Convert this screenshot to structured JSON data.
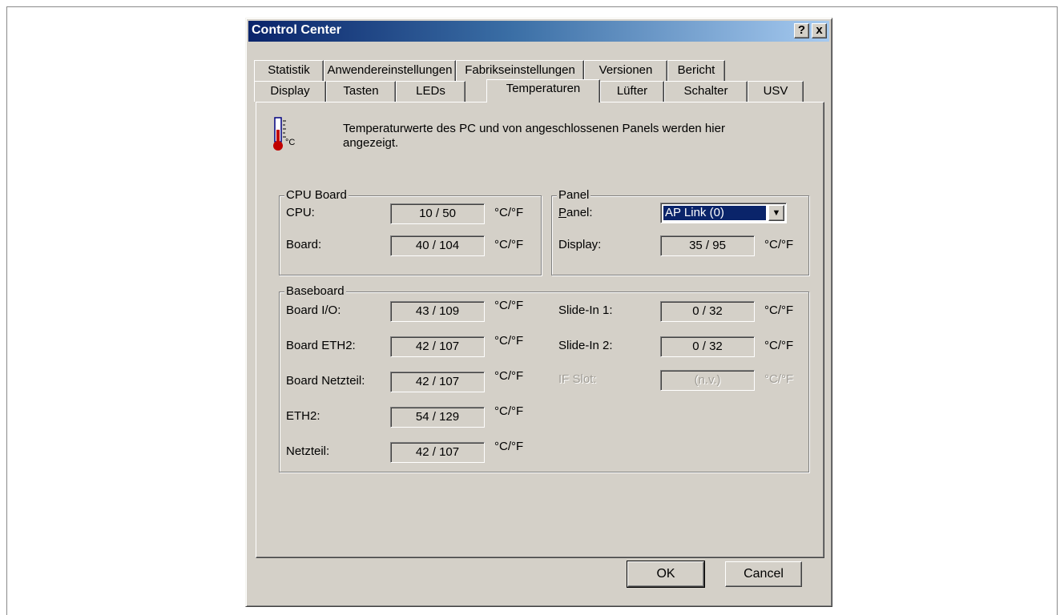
{
  "window": {
    "title": "Control Center",
    "help_glyph": "?",
    "close_glyph": "x"
  },
  "tabs_row1": [
    "Statistik",
    "Anwendereinstellungen",
    "Fabrikseinstellungen",
    "Versionen",
    "Bericht"
  ],
  "tabs_row2": [
    "Display",
    "Tasten",
    "LEDs",
    "Temperaturen",
    "Lüfter",
    "Schalter",
    "USV"
  ],
  "active_tab": "Temperaturen",
  "intro": {
    "icon": "thermometer-icon",
    "icon_unit": "°C",
    "line1": "Temperaturwerte des PC und von angeschlossenen Panels werden hier",
    "line2": "angezeigt."
  },
  "cpu_board": {
    "title": "CPU Board",
    "rows": [
      {
        "label": "CPU:",
        "value": "10 / 50",
        "unit": "°C/°F"
      },
      {
        "label": "Board:",
        "value": "40 / 104",
        "unit": "°C/°F"
      }
    ]
  },
  "panel": {
    "title": "Panel",
    "panel_label_prefix": "P",
    "panel_label_rest": "anel:",
    "selected": "AP Link (0)",
    "display_label": "Display:",
    "display_value": "35 / 95",
    "display_unit": "°C/°F"
  },
  "baseboard": {
    "title": "Baseboard",
    "left_rows": [
      {
        "label": "Board I/O:",
        "value": "43 / 109",
        "unit": "°C/°F"
      },
      {
        "label": "Board ETH2:",
        "value": "42 / 107",
        "unit": "°C/°F"
      },
      {
        "label": "Board Netzteil:",
        "value": "42 / 107",
        "unit": "°C/°F"
      },
      {
        "label": "ETH2:",
        "value": "54 / 129",
        "unit": "°C/°F"
      },
      {
        "label": "Netzteil:",
        "value": "42 / 107",
        "unit": "°C/°F"
      }
    ],
    "right_rows": [
      {
        "label": "Slide-In 1:",
        "value": "0 / 32",
        "unit": "°C/°F"
      },
      {
        "label": "Slide-In 2:",
        "value": "0 / 32",
        "unit": "°C/°F"
      },
      {
        "label": "IF Slot:",
        "value": "(n.v.)",
        "unit": "°C/°F"
      }
    ]
  },
  "buttons": {
    "ok": "OK",
    "cancel": "Cancel"
  },
  "colors": {
    "face": "#d4d0c8",
    "title_start": "#0a246a",
    "title_end": "#a6caf0",
    "selection": "#0a246a"
  }
}
